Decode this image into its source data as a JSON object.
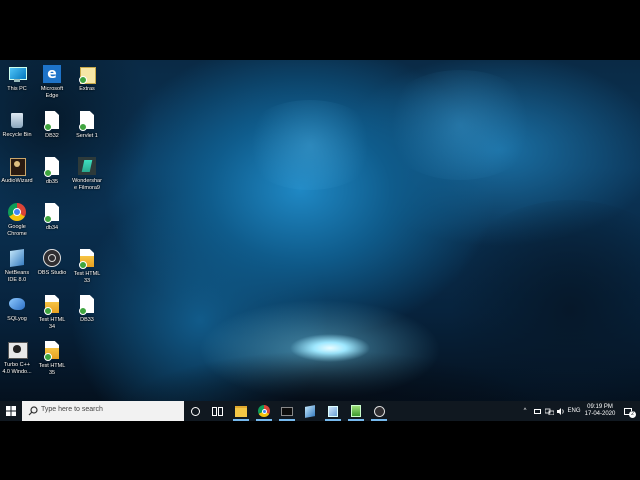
{
  "desktop": {
    "icons": [
      {
        "label": "This PC",
        "icon": "computer-icon"
      },
      {
        "label": "Microsoft Edge",
        "icon": "edge-icon"
      },
      {
        "label": "Extras",
        "icon": "folder-icon"
      },
      {
        "label": "Recycle Bin",
        "icon": "recycle-bin-icon"
      },
      {
        "label": "DB32",
        "icon": "document-icon"
      },
      {
        "label": "Servlet 1",
        "icon": "document-icon"
      },
      {
        "label": "AudioWizard",
        "icon": "audiowizard-icon"
      },
      {
        "label": "db35",
        "icon": "document-icon"
      },
      {
        "label": "Wondershare Filmora9",
        "icon": "filmora-icon"
      },
      {
        "label": "Google Chrome",
        "icon": "chrome-icon"
      },
      {
        "label": "db34",
        "icon": "document-icon"
      },
      {
        "label": "NetBeans IDE 8.0",
        "icon": "netbeans-icon"
      },
      {
        "label": "OBS Studio",
        "icon": "obs-icon"
      },
      {
        "label": "Test HTML 33",
        "icon": "html-file-icon"
      },
      {
        "label": "SQLyog",
        "icon": "sqlyog-icon"
      },
      {
        "label": "Test HTML 34",
        "icon": "html-file-icon"
      },
      {
        "label": "DB33",
        "icon": "document-icon"
      },
      {
        "label": "Turbo C++ 4.0 Windo...",
        "icon": "turbo-cpp-icon"
      },
      {
        "label": "Test HTML 35",
        "icon": "html-file-icon"
      }
    ]
  },
  "taskbar": {
    "search_placeholder": "Type here to search",
    "pinned": [
      "task-view-icon",
      "file-explorer-icon",
      "chrome-icon",
      "terminal-icon",
      "netbeans-icon",
      "virtualbox-icon",
      "notepad-icon",
      "obs-icon"
    ],
    "tray": {
      "language": "ENG",
      "time": "09:19 PM",
      "date": "17-04-2020",
      "notifications": "2"
    }
  },
  "colors": {
    "taskbar_bg": "#101820",
    "accent": "#76b9ed"
  }
}
